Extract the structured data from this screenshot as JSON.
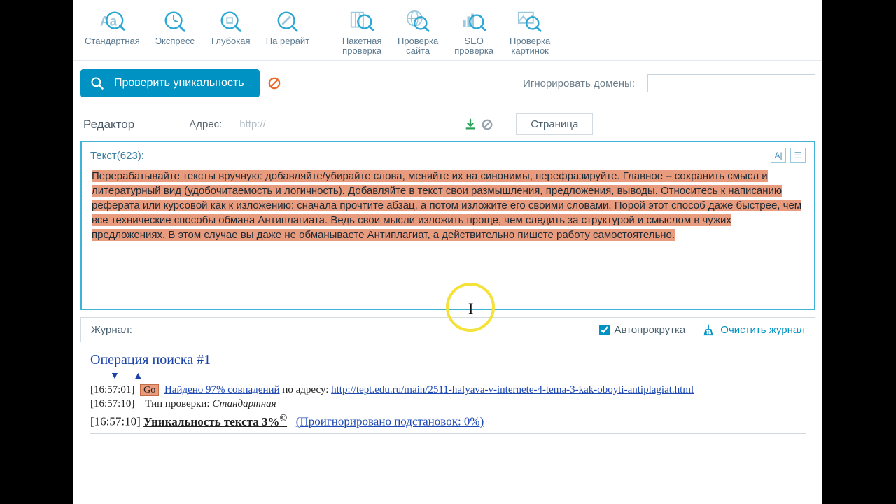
{
  "toolbar": {
    "standard": "Стандартная",
    "express": "Экспресс",
    "deep": "Глубокая",
    "rewrite": "На рерайт",
    "batch": "Пакетная\nпроверка",
    "site": "Проверка\nсайта",
    "seo": "SEO\nпроверка",
    "images": "Проверка\nкартинок"
  },
  "actions": {
    "check": "Проверить уникальность",
    "ignore_label": "Игнорировать домены:",
    "ignore_value": ""
  },
  "editor": {
    "tab": "Редактор",
    "address_label": "Адрес:",
    "address_value": "http://",
    "page_tab": "Страница"
  },
  "textpanel": {
    "header": "Текст(623):",
    "content": "Перерабатывайте тексты вручную: добавляйте/убирайте слова, меняйте их на синонимы, перефразируйте. Главное – сохранить смысл и литературный вид (удобочитаемость и логичность).\nДобавляйте в текст свои размышления, предложения, выводы. Относитесь к написанию реферата или курсовой как к изложению: сначала прочтите абзац, а потом изложите его своими словами. Порой этот способ даже быстрее, чем все технические способы обмана Антиплагиата. Ведь свои мысли изложить проще, чем следить за структурой и смыслом в чужих предложениях. В этом случае вы даже не обманываете Антиплагиат, а действительно пишете работу самостоятельно."
  },
  "log": {
    "label": "Журнал:",
    "autoscroll": "Автопрокрутка",
    "clear": "Очистить журнал",
    "op_title": "Операция поиска #1",
    "line1": {
      "time": "[16:57:01]",
      "go": "Go",
      "found": "Найдено 97% совпадений",
      "by": " по адресу: ",
      "url": "http://tept.edu.ru/main/2511-halyava-v-internete-4-tema-3-kak-oboyti-antiplagiat.html"
    },
    "line2": {
      "time": "[16:57:10]",
      "label": "Тип проверки: ",
      "value": "Стандартная"
    },
    "line3": {
      "time": "[16:57:10]",
      "uniq": "Уникальность текста 3%",
      "sup": "©",
      "ignored": "(Проигнорировано подстановок: 0%)"
    }
  }
}
